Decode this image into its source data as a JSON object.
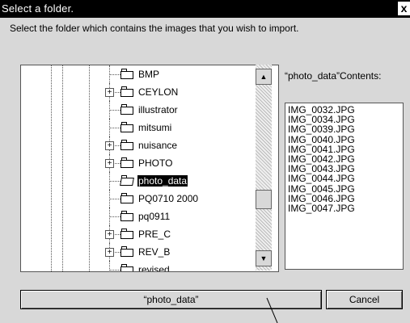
{
  "window": {
    "title": "Select a folder.",
    "close_label": "x"
  },
  "instruction": "Select the folder which contains the images that you wish to import.",
  "tree": {
    "items": [
      {
        "label": "BMP",
        "expandable": false,
        "selected": false
      },
      {
        "label": "CEYLON",
        "expandable": true,
        "selected": false
      },
      {
        "label": "illustrator",
        "expandable": false,
        "selected": false
      },
      {
        "label": "mitsumi",
        "expandable": false,
        "selected": false
      },
      {
        "label": "nuisance",
        "expandable": true,
        "selected": false
      },
      {
        "label": "PHOTO",
        "expandable": true,
        "selected": false
      },
      {
        "label": "photo_data",
        "expandable": false,
        "selected": true,
        "open": true
      },
      {
        "label": "PQ0710 2000",
        "expandable": false,
        "selected": false
      },
      {
        "label": "pq0911",
        "expandable": false,
        "selected": false
      },
      {
        "label": "PRE_C",
        "expandable": true,
        "selected": false
      },
      {
        "label": "REV_B",
        "expandable": true,
        "selected": false
      },
      {
        "label": "revised",
        "expandable": false,
        "selected": false
      }
    ],
    "expander_symbol": "+"
  },
  "scrollbar": {
    "up_arrow": "▲",
    "down_arrow": "▼"
  },
  "contents": {
    "label": "“photo_data”Contents:",
    "files": [
      "IMG_0032.JPG",
      "IMG_0034.JPG",
      "IMG_0039.JPG",
      "IMG_0040.JPG",
      "IMG_0041.JPG",
      "IMG_0042.JPG",
      "IMG_0043.JPG",
      "IMG_0044.JPG",
      "IMG_0045.JPG",
      "IMG_0046.JPG",
      "IMG_0047.JPG"
    ]
  },
  "buttons": {
    "ok_label": "“photo_data”",
    "cancel_label": "Cancel"
  }
}
